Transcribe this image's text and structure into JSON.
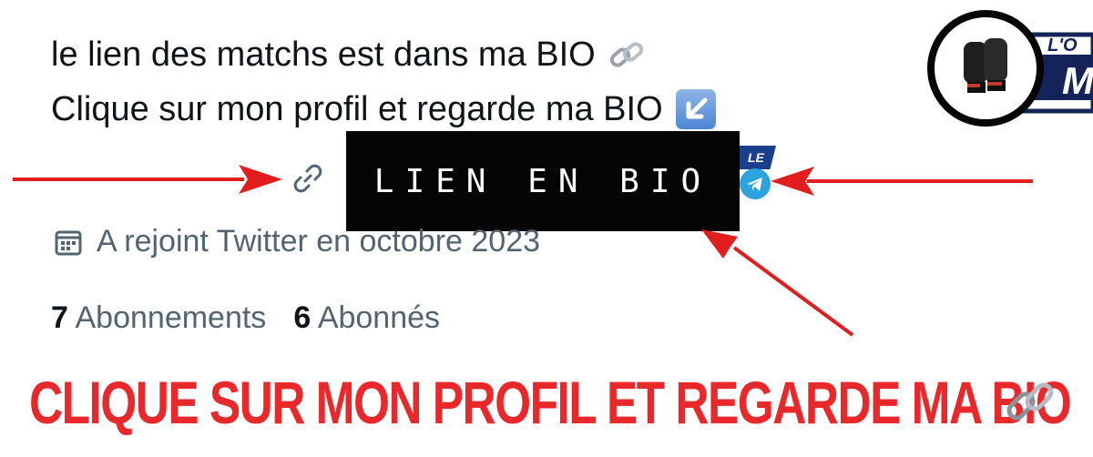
{
  "bio": {
    "line1": "le lien des matchs est dans ma BIO",
    "line2": "Clique sur mon profil et regarde ma BIO"
  },
  "overlay": {
    "black_box_text": "LIEN EN BIO"
  },
  "profile": {
    "joined": "A rejoint Twitter en octobre 2023",
    "following_count": "7",
    "following_label": "Abonnements",
    "followers_count": "6",
    "followers_label": "Abonnés"
  },
  "cta": {
    "text": "CLIQUE SUR MON PROFIL ET REGARDE MA BIO"
  },
  "logo": {
    "text_top": "L'O",
    "text_big": "M",
    "badge_fragment": "LE"
  },
  "colors": {
    "cta_red": "#e8282a",
    "arrow_red": "#e11d1d",
    "muted_text": "#536471",
    "primary_text": "#0f1419",
    "logo_navy": "#14245a",
    "telegram_blue": "#2aa3df"
  },
  "icons": [
    "link-chain-emoji",
    "down-left-arrow-emoji",
    "link-icon",
    "telegram-icon",
    "calendar-icon",
    "boxing-glove-icon"
  ]
}
